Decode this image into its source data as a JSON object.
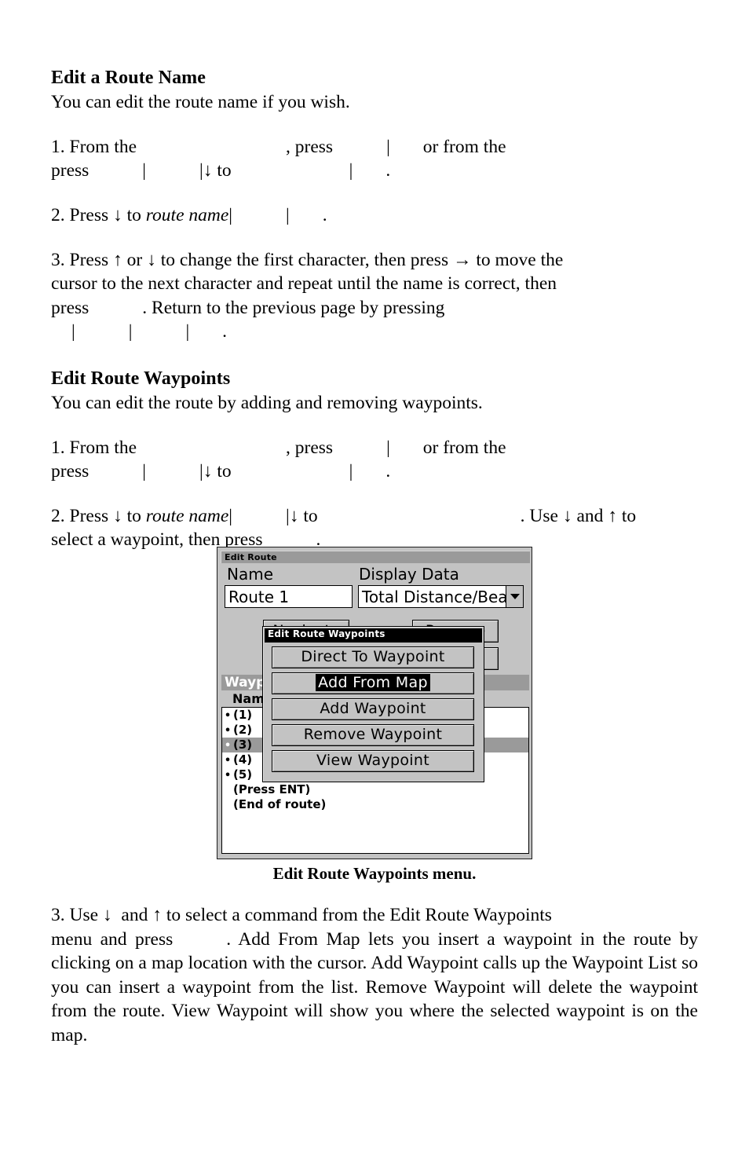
{
  "page": {
    "sections": [
      {
        "heading": "Edit a Route Name",
        "intro": "You can edit the route name if you wish.",
        "steps": [
          {
            "number": "1.",
            "segments": [
              "From  the",
              ",  press",
              "|",
              "or  from  the",
              "press",
              "|",
              "|",
              "to",
              "|",
              "."
            ]
          },
          {
            "number": "2.",
            "segments": [
              "Press",
              "to",
              "route name",
              "|",
              "|",
              "."
            ]
          },
          {
            "number": "3.",
            "segments": [
              "Press ↑ or ↓ to change the first character, then press → to move the",
              "cursor to the next character and repeat until the name is correct, then",
              "press",
              ".   Return    to    the    previous    page    by    pressing",
              "|",
              "|",
              "|",
              "."
            ]
          }
        ]
      },
      {
        "heading": "Edit Route Waypoints",
        "intro": "You can edit the route by adding and removing waypoints.",
        "steps": [
          {
            "number": "1.",
            "segments": [
              "From  the",
              ",  press",
              "|",
              "or  from  the",
              "press",
              "|",
              "|",
              "to",
              "|",
              "."
            ]
          },
          {
            "number": "2.",
            "segments": [
              "Press",
              "to",
              "route name",
              "|",
              "|",
              "to",
              ". Use",
              "and",
              "to",
              "select a waypoint, then press",
              "."
            ]
          }
        ]
      }
    ],
    "text": {
      "h1": "Edit a Route Name",
      "p_intro1": "You can edit the route name if you wish.",
      "step1_a": "1.  From  the",
      "step1_b": ",  press",
      "step1_pipe": "|",
      "step1_c": "or  from  the",
      "step1_d": "press",
      "step1_e": "to",
      "step1_f": ".",
      "step2_a": "2. Press",
      "step2_arrow": "↓",
      "step2_b": "to",
      "step2_italic": "route name",
      "step2_f": ".",
      "step3_line1": "3. Press ↑ or ↓ to change the first character, then press → to move the",
      "step3_line2": "cursor to the next character and repeat until the name is correct, then",
      "step3_press": "press",
      "step3_rest": ".    Return     to     the     previous     page     by     pressing",
      "step3_end": ".",
      "h2": "Edit Route Waypoints",
      "p_intro2": "You can edit the route by adding and removing waypoints.",
      "s2_step2_a": "2. Press",
      "s2_step2_b": "to",
      "s2_step2_italic": "route name",
      "s2_step2_c": "to",
      "s2_step2_d": ". Use",
      "s2_step2_e": "and",
      "s2_step2_f": "to",
      "s2_step2_g": "select a waypoint, then press",
      "s2_step2_h": ".",
      "caption": "Edit Route Waypoints menu.",
      "step3_final_a": "3. Use",
      "step3_final_b": "and",
      "step3_final_c": "to select a command from the Edit Route Waypoints",
      "step3_final_d": "menu and press",
      "step3_final_e": ". Add From Map lets you insert a waypoint in the route by clicking on a map location with the cursor. Add Waypoint calls up the Waypoint List so you can insert a waypoint from the list. Remove Waypoint will delete the waypoint from the route. View Waypoint will show you where the selected waypoint is on the map.",
      "arrow_down": "↓",
      "arrow_up": "↑",
      "arrow_right": "→",
      "pipe": "|"
    }
  },
  "device": {
    "window_title": "Edit Route",
    "labels": {
      "name": "Name",
      "display_data": "Display Data"
    },
    "fields": {
      "name_value": "Route 1",
      "display_data_value": "Total Distance/Bearing"
    },
    "background_buttons": [
      {
        "label": "Navigate"
      },
      {
        "label": "Reverse"
      },
      {
        "label": ""
      },
      {
        "label": ""
      }
    ],
    "waypoints_panel": {
      "header": "Waypoints",
      "column_header": "Name",
      "rows": [
        {
          "bullet": "•",
          "label": "(1)",
          "selected": false
        },
        {
          "bullet": "•",
          "label": "(2)",
          "selected": false
        },
        {
          "bullet": "•",
          "label": "(3)",
          "selected": true
        },
        {
          "bullet": "•",
          "label": "(4)",
          "selected": false
        },
        {
          "bullet": "•",
          "label": "(5)",
          "selected": false
        },
        {
          "bullet": "",
          "label": "(Press ENT)",
          "selected": false
        },
        {
          "bullet": "",
          "label": "(End of route)",
          "selected": false
        }
      ]
    },
    "popup": {
      "title": "Edit Route Waypoints",
      "items": [
        {
          "label": "Direct To Waypoint",
          "highlighted": false
        },
        {
          "label": "Add From Map",
          "highlighted": true
        },
        {
          "label": "Add Waypoint",
          "highlighted": false
        },
        {
          "label": "Remove Waypoint",
          "highlighted": false
        },
        {
          "label": "View Waypoint",
          "highlighted": false
        }
      ]
    },
    "colors": {
      "shell_gray": "#c3c3c3",
      "titlebar_gray": "#9a9a9a",
      "highlight_black": "#000000",
      "field_white": "#ffffff"
    }
  }
}
